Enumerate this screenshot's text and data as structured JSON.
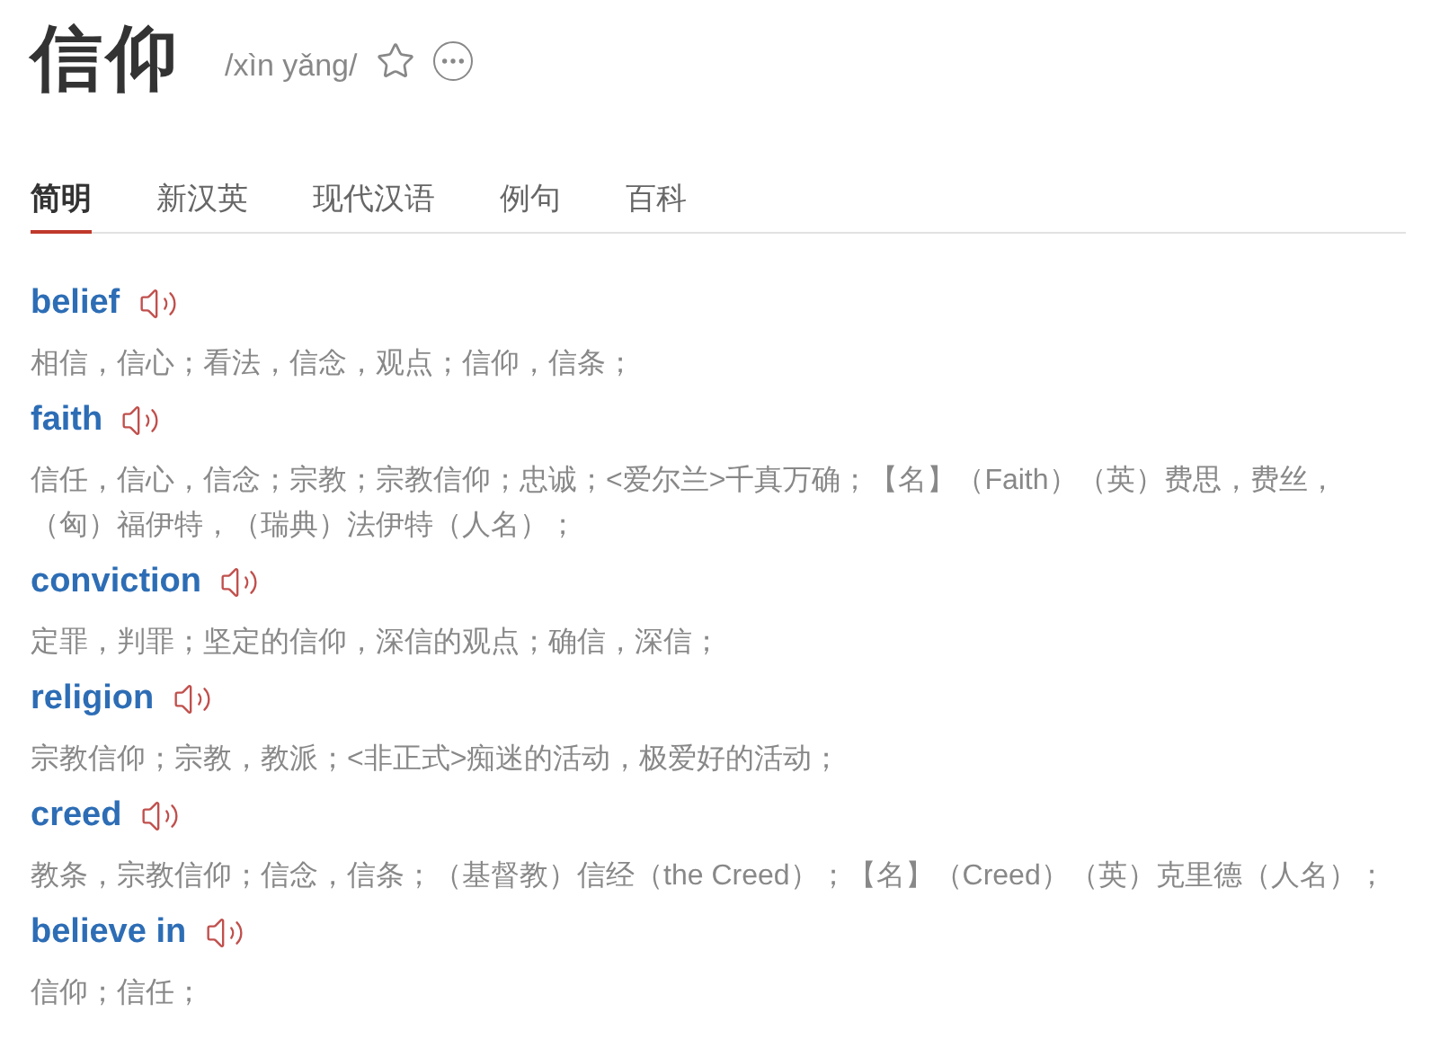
{
  "header": {
    "word": "信仰",
    "pinyin": "/xìn yǎng/"
  },
  "tabs": [
    {
      "label": "简明",
      "selected": true
    },
    {
      "label": "新汉英",
      "selected": false
    },
    {
      "label": "现代汉语",
      "selected": false
    },
    {
      "label": "例句",
      "selected": false
    },
    {
      "label": "百科",
      "selected": false
    }
  ],
  "entries": [
    {
      "word": "belief",
      "definition": "相信，信心；看法，信念，观点；信仰，信条；"
    },
    {
      "word": "faith",
      "definition": "信任，信心，信念；宗教；宗教信仰；忠诚；<爱尔兰>千真万确；【名】（Faith）（英）费思，费丝，（匈）福伊特，（瑞典）法伊特（人名）；"
    },
    {
      "word": "conviction",
      "definition": "定罪，判罪；坚定的信仰，深信的观点；确信，深信；"
    },
    {
      "word": "religion",
      "definition": "宗教信仰；宗教，教派；<非正式>痴迷的活动，极爱好的活动；"
    },
    {
      "word": "creed",
      "definition": "教条，宗教信仰；信念，信条；（基督教）信经（the Creed）；【名】（Creed）（英）克里德（人名）；"
    },
    {
      "word": "believe in",
      "definition": "信仰；信任；"
    }
  ]
}
